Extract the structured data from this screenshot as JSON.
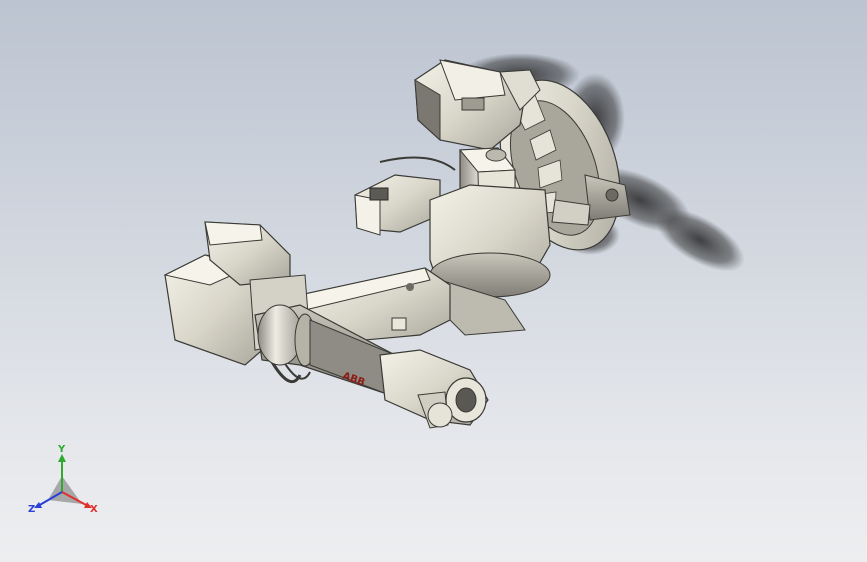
{
  "viewport": {
    "model_decal": "ABB"
  },
  "triad": {
    "x_label": "X",
    "y_label": "Y",
    "z_label": "Z",
    "x_color": "#e0302a",
    "y_color": "#2faa2f",
    "z_color": "#2a3fd8"
  },
  "icons": {
    "axis_triad": "coordinate-triad-icon"
  }
}
